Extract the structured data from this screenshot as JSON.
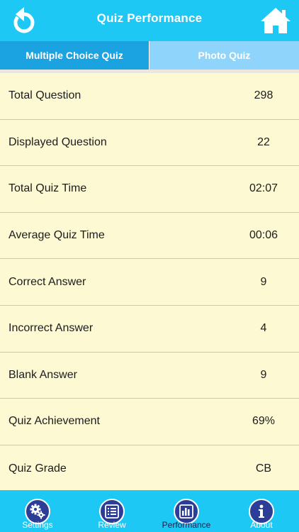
{
  "header": {
    "title": "Quiz Performance",
    "back_icon": "refresh-back-icon",
    "home_icon": "home-icon"
  },
  "tabs": [
    {
      "label": "Multiple Choice Quiz",
      "active": true
    },
    {
      "label": "Photo Quiz",
      "active": false
    }
  ],
  "stats": [
    {
      "label": "Total Question",
      "value": "298"
    },
    {
      "label": "Displayed Question",
      "value": "22"
    },
    {
      "label": "Total Quiz Time",
      "value": "02:07"
    },
    {
      "label": "Average Quiz Time",
      "value": "00:06"
    },
    {
      "label": "Correct Answer",
      "value": "9"
    },
    {
      "label": "Incorrect Answer",
      "value": "4"
    },
    {
      "label": "Blank Answer",
      "value": "9"
    },
    {
      "label": "Quiz Achievement",
      "value": "69%"
    },
    {
      "label": "Quiz Grade",
      "value": "CB"
    }
  ],
  "bottom_nav": [
    {
      "label": "Settings",
      "icon": "gears-icon"
    },
    {
      "label": "Review",
      "icon": "list-icon"
    },
    {
      "label": "Performance",
      "icon": "bar-chart-icon",
      "active": true
    },
    {
      "label": "About",
      "icon": "info-icon"
    }
  ],
  "colors": {
    "header_bg": "#1ec8f5",
    "tab_active_bg": "#1ba2e0",
    "tab_inactive_bg": "#8fd4fb",
    "list_bg": "#fdf9d3",
    "icon_circle": "#2b3d97"
  }
}
